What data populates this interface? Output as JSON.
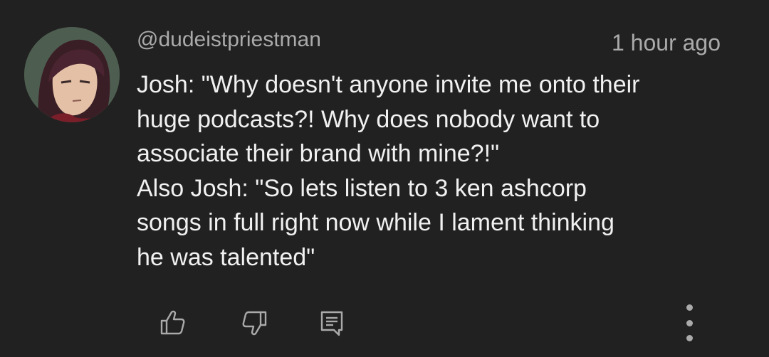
{
  "comment": {
    "username": "@dudeistpriestman",
    "timestamp": "1 hour ago",
    "lines": [
      "Josh: \"Why doesn't anyone invite me onto their",
      "huge podcasts?! Why does nobody want to",
      "associate their brand with mine?!\"",
      "Also Josh: \"So lets listen to 3 ken ashcorp",
      "songs in full right now while I lament thinking",
      "he was talented\""
    ]
  },
  "actions": {
    "like_icon": "thumbs-up-icon",
    "dislike_icon": "thumbs-down-icon",
    "reply_icon": "comment-reply-icon",
    "more_icon": "vertical-ellipsis-icon"
  },
  "colors": {
    "background": "#212121",
    "text": "#f1f1f1",
    "secondary_text": "#aaaaaa"
  }
}
